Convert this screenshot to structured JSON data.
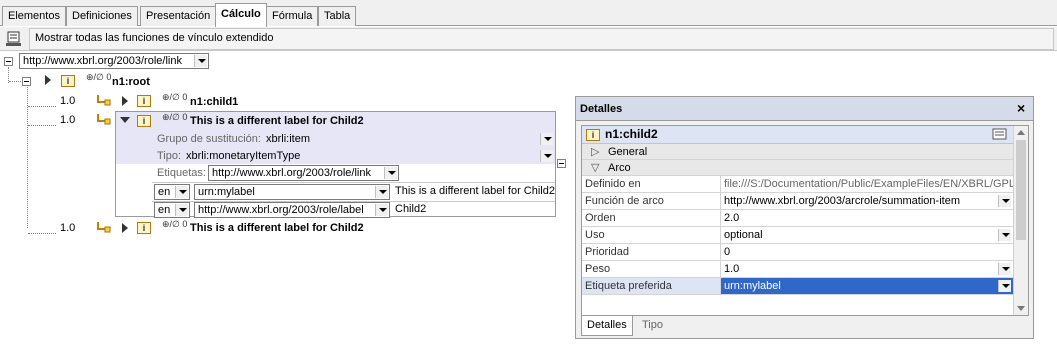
{
  "tabs": [
    "Elementos",
    "Definiciones",
    "Presentación",
    "Cálculo",
    "Fórmula",
    "Tabla"
  ],
  "toolbar": {
    "label": "Mostrar todas las funciones de vínculo extendido"
  },
  "tree": {
    "role_link": "http://www.xbrl.org/2003/role/link",
    "root_name": "n1:root",
    "node_badge": "⊕/∅ 0",
    "ibox": "i",
    "child1": {
      "weight": "1.0",
      "name": "n1:child1"
    },
    "child2": {
      "weight": "1.0",
      "name": "This is a different label for Child2",
      "grupo_label": "Grupo de sustitución:",
      "grupo_value": "xbrli:item",
      "tipo_label": "Tipo:",
      "tipo_value": "xbrli:monetaryItemType",
      "etiquetas_label": "Etiquetas:",
      "etiquetas_value": "http://www.xbrl.org/2003/role/link",
      "labels": [
        {
          "lang": "en",
          "role": "urn:mylabel",
          "text": "This is a different label for Child2"
        },
        {
          "lang": "en",
          "role": "http://www.xbrl.org/2003/role/label",
          "text": "Child2"
        }
      ]
    },
    "child3": {
      "weight": "1.0",
      "name": "This is a different label for Child2"
    }
  },
  "details": {
    "title": "Detalles",
    "close": "×",
    "element_name": "n1:child2",
    "sections": {
      "general": "General",
      "arco": "Arco"
    },
    "rows": [
      {
        "key": "Definido en",
        "value": "file:///S:/Documentation/Public/ExampleFiles/EN/XBRL/GPL/",
        "combo": false,
        "greyed": true
      },
      {
        "key": "Función de arco",
        "value": "http://www.xbrl.org/2003/arcrole/summation-item",
        "combo": true
      },
      {
        "key": "Orden",
        "value": "2.0",
        "combo": false
      },
      {
        "key": "Uso",
        "value": "optional",
        "combo": true
      },
      {
        "key": "Prioridad",
        "value": "0",
        "combo": false
      },
      {
        "key": "Peso",
        "value": "1.0",
        "combo": true
      },
      {
        "key": "Etiqueta preferida",
        "value": "urn:mylabel",
        "combo": true,
        "selected": true
      }
    ],
    "tabs": [
      "Detalles",
      "Tipo"
    ]
  },
  "colors": {
    "selection": "#3068c8",
    "panel_header": "#e6e6f7",
    "title_bar": "#d6dbe9"
  }
}
